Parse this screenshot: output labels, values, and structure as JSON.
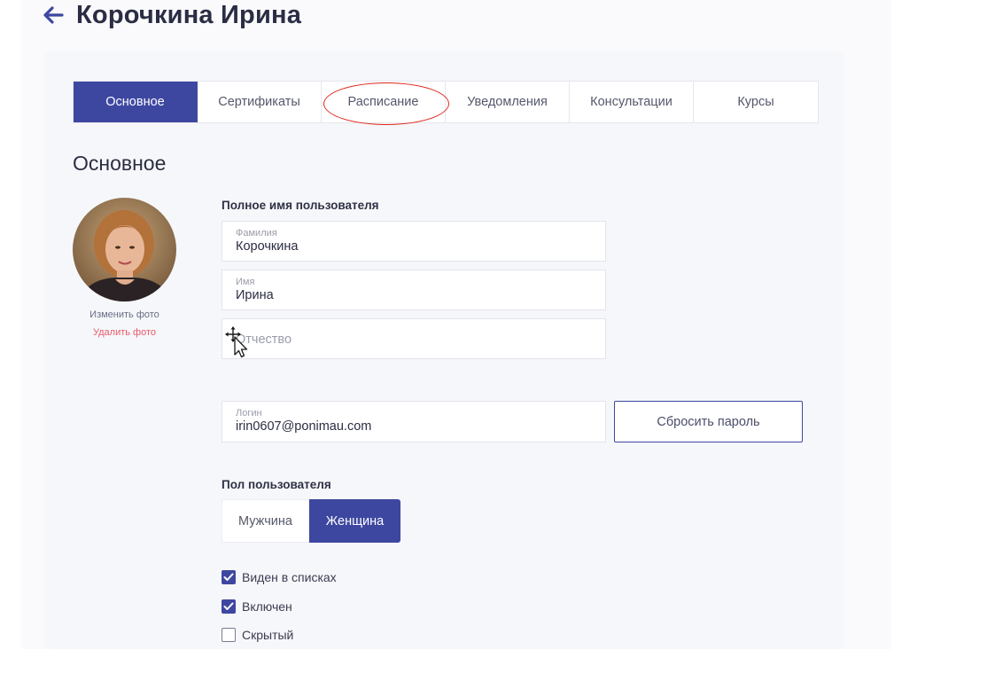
{
  "header": {
    "title": "Корочкина Ирина",
    "back_icon": "arrow-left-icon"
  },
  "tabs": [
    {
      "label": "Основное",
      "active": true
    },
    {
      "label": "Сертификаты",
      "active": false
    },
    {
      "label": "Расписание",
      "active": false
    },
    {
      "label": "Уведомления",
      "active": false
    },
    {
      "label": "Консультации",
      "active": false
    },
    {
      "label": "Курсы",
      "active": false
    }
  ],
  "section": {
    "title": "Основное"
  },
  "photo": {
    "change_label": "Изменить фото",
    "delete_label": "Удалить фото"
  },
  "full_name": {
    "label": "Полное имя пользователя",
    "last_name": {
      "label": "Фамилия",
      "value": "Корочкина"
    },
    "first_name": {
      "label": "Имя",
      "value": "Ирина"
    },
    "patronymic": {
      "placeholder": "Отчество",
      "value": ""
    }
  },
  "login": {
    "label": "Логин",
    "value": "irin0607@ponimau.com",
    "reset_label": "Сбросить пароль"
  },
  "gender": {
    "label": "Пол пользователя",
    "options": [
      "Мужчина",
      "Женщина"
    ],
    "selected": "Женщина"
  },
  "checkboxes": [
    {
      "label": "Виден в списках",
      "checked": true
    },
    {
      "label": "Включен",
      "checked": true
    },
    {
      "label": "Скрытый",
      "checked": false
    }
  ],
  "colors": {
    "accent": "#3e47a0",
    "delete": "#e85a6a",
    "annotation": "#e0241b"
  }
}
